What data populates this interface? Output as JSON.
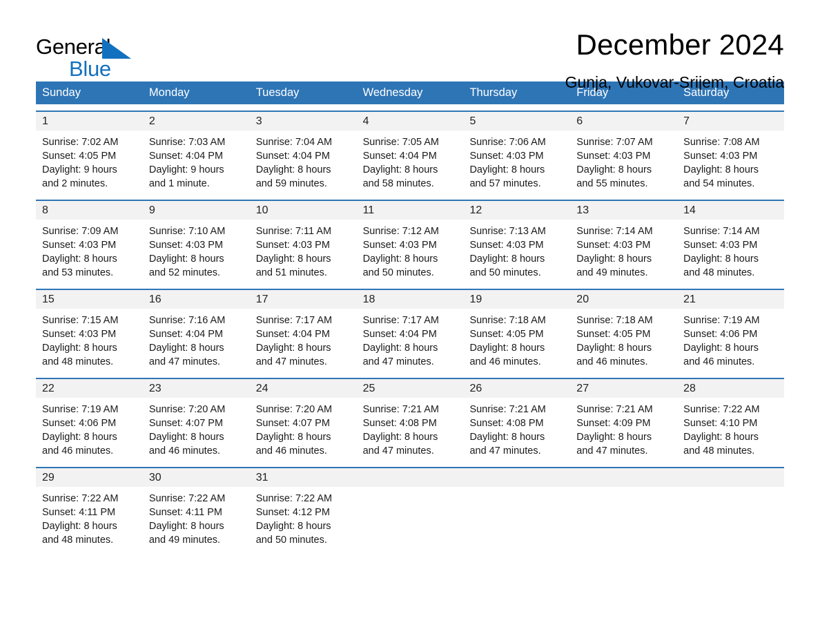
{
  "brand": {
    "name_part1": "General",
    "name_part2": "Blue",
    "accent_color": "#1271bf"
  },
  "header": {
    "title": "December 2024",
    "location": "Gunja, Vukovar-Srijem, Croatia"
  },
  "theme": {
    "header_blue": "#2e75b6",
    "daynum_band": "#f2f2f2",
    "text": "#1a1a1a"
  },
  "weekdays": [
    "Sunday",
    "Monday",
    "Tuesday",
    "Wednesday",
    "Thursday",
    "Friday",
    "Saturday"
  ],
  "weeks": [
    [
      {
        "day": "1",
        "sunrise": "Sunrise: 7:02 AM",
        "sunset": "Sunset: 4:05 PM",
        "daylight_line1": "Daylight: 9 hours",
        "daylight_line2": "and 2 minutes."
      },
      {
        "day": "2",
        "sunrise": "Sunrise: 7:03 AM",
        "sunset": "Sunset: 4:04 PM",
        "daylight_line1": "Daylight: 9 hours",
        "daylight_line2": "and 1 minute."
      },
      {
        "day": "3",
        "sunrise": "Sunrise: 7:04 AM",
        "sunset": "Sunset: 4:04 PM",
        "daylight_line1": "Daylight: 8 hours",
        "daylight_line2": "and 59 minutes."
      },
      {
        "day": "4",
        "sunrise": "Sunrise: 7:05 AM",
        "sunset": "Sunset: 4:04 PM",
        "daylight_line1": "Daylight: 8 hours",
        "daylight_line2": "and 58 minutes."
      },
      {
        "day": "5",
        "sunrise": "Sunrise: 7:06 AM",
        "sunset": "Sunset: 4:03 PM",
        "daylight_line1": "Daylight: 8 hours",
        "daylight_line2": "and 57 minutes."
      },
      {
        "day": "6",
        "sunrise": "Sunrise: 7:07 AM",
        "sunset": "Sunset: 4:03 PM",
        "daylight_line1": "Daylight: 8 hours",
        "daylight_line2": "and 55 minutes."
      },
      {
        "day": "7",
        "sunrise": "Sunrise: 7:08 AM",
        "sunset": "Sunset: 4:03 PM",
        "daylight_line1": "Daylight: 8 hours",
        "daylight_line2": "and 54 minutes."
      }
    ],
    [
      {
        "day": "8",
        "sunrise": "Sunrise: 7:09 AM",
        "sunset": "Sunset: 4:03 PM",
        "daylight_line1": "Daylight: 8 hours",
        "daylight_line2": "and 53 minutes."
      },
      {
        "day": "9",
        "sunrise": "Sunrise: 7:10 AM",
        "sunset": "Sunset: 4:03 PM",
        "daylight_line1": "Daylight: 8 hours",
        "daylight_line2": "and 52 minutes."
      },
      {
        "day": "10",
        "sunrise": "Sunrise: 7:11 AM",
        "sunset": "Sunset: 4:03 PM",
        "daylight_line1": "Daylight: 8 hours",
        "daylight_line2": "and 51 minutes."
      },
      {
        "day": "11",
        "sunrise": "Sunrise: 7:12 AM",
        "sunset": "Sunset: 4:03 PM",
        "daylight_line1": "Daylight: 8 hours",
        "daylight_line2": "and 50 minutes."
      },
      {
        "day": "12",
        "sunrise": "Sunrise: 7:13 AM",
        "sunset": "Sunset: 4:03 PM",
        "daylight_line1": "Daylight: 8 hours",
        "daylight_line2": "and 50 minutes."
      },
      {
        "day": "13",
        "sunrise": "Sunrise: 7:14 AM",
        "sunset": "Sunset: 4:03 PM",
        "daylight_line1": "Daylight: 8 hours",
        "daylight_line2": "and 49 minutes."
      },
      {
        "day": "14",
        "sunrise": "Sunrise: 7:14 AM",
        "sunset": "Sunset: 4:03 PM",
        "daylight_line1": "Daylight: 8 hours",
        "daylight_line2": "and 48 minutes."
      }
    ],
    [
      {
        "day": "15",
        "sunrise": "Sunrise: 7:15 AM",
        "sunset": "Sunset: 4:03 PM",
        "daylight_line1": "Daylight: 8 hours",
        "daylight_line2": "and 48 minutes."
      },
      {
        "day": "16",
        "sunrise": "Sunrise: 7:16 AM",
        "sunset": "Sunset: 4:04 PM",
        "daylight_line1": "Daylight: 8 hours",
        "daylight_line2": "and 47 minutes."
      },
      {
        "day": "17",
        "sunrise": "Sunrise: 7:17 AM",
        "sunset": "Sunset: 4:04 PM",
        "daylight_line1": "Daylight: 8 hours",
        "daylight_line2": "and 47 minutes."
      },
      {
        "day": "18",
        "sunrise": "Sunrise: 7:17 AM",
        "sunset": "Sunset: 4:04 PM",
        "daylight_line1": "Daylight: 8 hours",
        "daylight_line2": "and 47 minutes."
      },
      {
        "day": "19",
        "sunrise": "Sunrise: 7:18 AM",
        "sunset": "Sunset: 4:05 PM",
        "daylight_line1": "Daylight: 8 hours",
        "daylight_line2": "and 46 minutes."
      },
      {
        "day": "20",
        "sunrise": "Sunrise: 7:18 AM",
        "sunset": "Sunset: 4:05 PM",
        "daylight_line1": "Daylight: 8 hours",
        "daylight_line2": "and 46 minutes."
      },
      {
        "day": "21",
        "sunrise": "Sunrise: 7:19 AM",
        "sunset": "Sunset: 4:06 PM",
        "daylight_line1": "Daylight: 8 hours",
        "daylight_line2": "and 46 minutes."
      }
    ],
    [
      {
        "day": "22",
        "sunrise": "Sunrise: 7:19 AM",
        "sunset": "Sunset: 4:06 PM",
        "daylight_line1": "Daylight: 8 hours",
        "daylight_line2": "and 46 minutes."
      },
      {
        "day": "23",
        "sunrise": "Sunrise: 7:20 AM",
        "sunset": "Sunset: 4:07 PM",
        "daylight_line1": "Daylight: 8 hours",
        "daylight_line2": "and 46 minutes."
      },
      {
        "day": "24",
        "sunrise": "Sunrise: 7:20 AM",
        "sunset": "Sunset: 4:07 PM",
        "daylight_line1": "Daylight: 8 hours",
        "daylight_line2": "and 46 minutes."
      },
      {
        "day": "25",
        "sunrise": "Sunrise: 7:21 AM",
        "sunset": "Sunset: 4:08 PM",
        "daylight_line1": "Daylight: 8 hours",
        "daylight_line2": "and 47 minutes."
      },
      {
        "day": "26",
        "sunrise": "Sunrise: 7:21 AM",
        "sunset": "Sunset: 4:08 PM",
        "daylight_line1": "Daylight: 8 hours",
        "daylight_line2": "and 47 minutes."
      },
      {
        "day": "27",
        "sunrise": "Sunrise: 7:21 AM",
        "sunset": "Sunset: 4:09 PM",
        "daylight_line1": "Daylight: 8 hours",
        "daylight_line2": "and 47 minutes."
      },
      {
        "day": "28",
        "sunrise": "Sunrise: 7:22 AM",
        "sunset": "Sunset: 4:10 PM",
        "daylight_line1": "Daylight: 8 hours",
        "daylight_line2": "and 48 minutes."
      }
    ],
    [
      {
        "day": "29",
        "sunrise": "Sunrise: 7:22 AM",
        "sunset": "Sunset: 4:11 PM",
        "daylight_line1": "Daylight: 8 hours",
        "daylight_line2": "and 48 minutes."
      },
      {
        "day": "30",
        "sunrise": "Sunrise: 7:22 AM",
        "sunset": "Sunset: 4:11 PM",
        "daylight_line1": "Daylight: 8 hours",
        "daylight_line2": "and 49 minutes."
      },
      {
        "day": "31",
        "sunrise": "Sunrise: 7:22 AM",
        "sunset": "Sunset: 4:12 PM",
        "daylight_line1": "Daylight: 8 hours",
        "daylight_line2": "and 50 minutes."
      },
      {
        "day": "",
        "sunrise": "",
        "sunset": "",
        "daylight_line1": "",
        "daylight_line2": ""
      },
      {
        "day": "",
        "sunrise": "",
        "sunset": "",
        "daylight_line1": "",
        "daylight_line2": ""
      },
      {
        "day": "",
        "sunrise": "",
        "sunset": "",
        "daylight_line1": "",
        "daylight_line2": ""
      },
      {
        "day": "",
        "sunrise": "",
        "sunset": "",
        "daylight_line1": "",
        "daylight_line2": ""
      }
    ]
  ]
}
